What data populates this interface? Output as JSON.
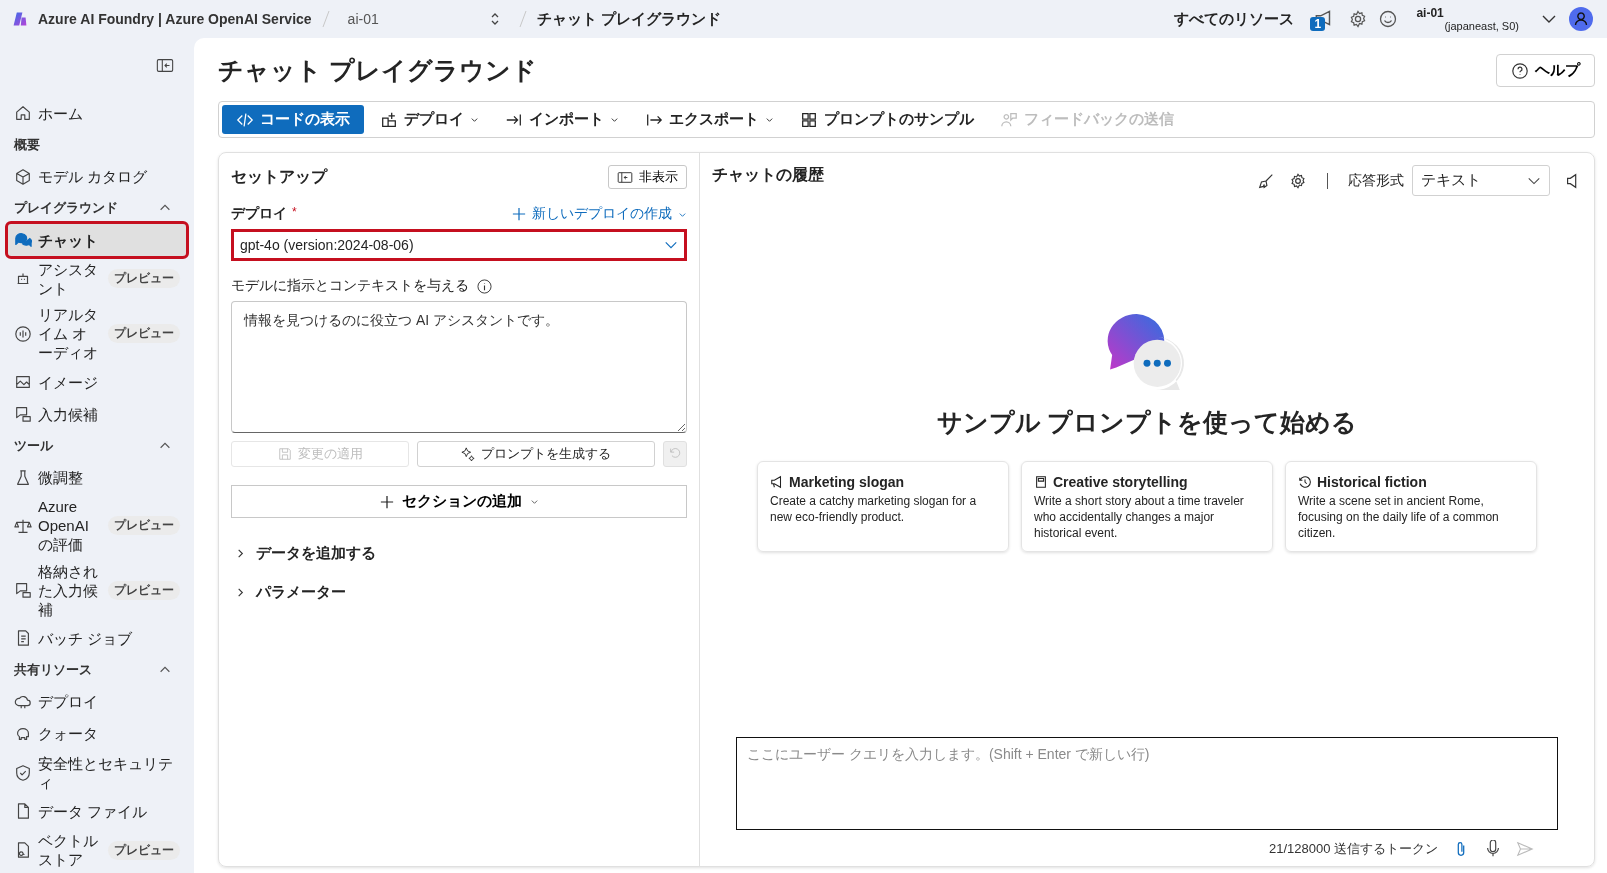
{
  "topbar": {
    "brand": "Azure AI Foundry | Azure OpenAI Service",
    "breadcrumb": [
      {
        "label": "ai-01",
        "kind": "selector"
      },
      {
        "label": "チャット プレイグラウンド",
        "kind": "page"
      }
    ],
    "resources_link": "すべてのリソース",
    "notification_count": "1",
    "account": {
      "name": "ai-01",
      "detail": "(japaneast, S0)"
    }
  },
  "sidebar": {
    "groups": [
      {
        "kind": "none",
        "items": [
          {
            "label": "ホーム",
            "selected": false,
            "highlighted": false
          }
        ]
      },
      {
        "kind": "static",
        "heading": "概要",
        "items": [
          {
            "label": "モデル カタログ",
            "selected": false,
            "highlighted": false
          }
        ]
      },
      {
        "kind": "collapsible",
        "heading": "プレイグラウンド",
        "expanded": true,
        "items": [
          {
            "label": "チャット",
            "selected": true,
            "highlighted": true
          },
          {
            "label": "アシスタント",
            "selected": false,
            "highlighted": false,
            "badge": "プレビュー"
          },
          {
            "label": "リアルタイム オーディオ",
            "selected": false,
            "highlighted": false,
            "badge": "プレビュー"
          },
          {
            "label": "イメージ",
            "selected": false,
            "highlighted": false
          },
          {
            "label": "入力候補",
            "selected": false,
            "highlighted": false
          }
        ]
      },
      {
        "kind": "collapsible",
        "heading": "ツール",
        "expanded": true,
        "items": [
          {
            "label": "微調整",
            "selected": false,
            "highlighted": false
          },
          {
            "label": "Azure OpenAI の評価",
            "selected": false,
            "highlighted": false,
            "badge": "プレビュー"
          },
          {
            "label": "格納された入力候補",
            "selected": false,
            "highlighted": false,
            "badge": "プレビュー"
          },
          {
            "label": "バッチ ジョブ",
            "selected": false,
            "highlighted": false
          }
        ]
      },
      {
        "kind": "collapsible",
        "heading": "共有リソース",
        "expanded": true,
        "items": [
          {
            "label": "デプロイ",
            "selected": false,
            "highlighted": false
          },
          {
            "label": "クォータ",
            "selected": false,
            "highlighted": false
          },
          {
            "label": "安全性とセキュリティ",
            "selected": false,
            "highlighted": false
          },
          {
            "label": "データ ファイル",
            "selected": false,
            "highlighted": false
          },
          {
            "label": "ベクトルストア",
            "selected": false,
            "highlighted": false,
            "badge": "プレビュー"
          }
        ]
      }
    ]
  },
  "page": {
    "title": "チャット プレイグラウンド",
    "help_button": "ヘルプ"
  },
  "toolbar": [
    {
      "label": "コードの表示",
      "kind": "primary",
      "has_menu": false,
      "disabled": false
    },
    {
      "label": "デプロイ",
      "kind": "default",
      "has_menu": true,
      "disabled": false
    },
    {
      "label": "インポート",
      "kind": "default",
      "has_menu": true,
      "disabled": false
    },
    {
      "label": "エクスポート",
      "kind": "default",
      "has_menu": true,
      "disabled": false
    },
    {
      "label": "プロンプトのサンプル",
      "kind": "default",
      "has_menu": false,
      "disabled": false
    },
    {
      "label": "フィードバックの送信",
      "kind": "default",
      "has_menu": false,
      "disabled": true
    }
  ],
  "setup": {
    "title": "セットアップ",
    "hide_button": "非表示",
    "deploy_label": "デプロイ",
    "required_mark": "*",
    "new_deploy_link": "新しいデプロイの作成",
    "deploy_select": {
      "value": "gpt-4o (version:2024-08-06)",
      "highlighted": true
    },
    "instructions_label": "モデルに指示とコンテキストを与える",
    "instructions_value": "情報を見つけるのに役立つ AI アシスタントです。",
    "apply_button": {
      "label": "変更の適用",
      "disabled": true
    },
    "generate_button": {
      "label": "プロンプトを生成する",
      "disabled": false
    },
    "reset_button": {
      "disabled": true
    },
    "add_section_button": "セクションの追加",
    "sections": [
      {
        "label": "データを追加する",
        "expanded": false
      },
      {
        "label": "パラメーター",
        "expanded": false
      }
    ]
  },
  "chat": {
    "title": "チャットの履歴",
    "response_format_label": "応答形式",
    "response_format_value": "テキスト",
    "heading": "サンプル プロンプトを使って始める",
    "samples": [
      {
        "title": "Marketing slogan",
        "text": "Create a catchy marketing slogan for a new eco-friendly product."
      },
      {
        "title": "Creative storytelling",
        "text": "Write a short story about a time traveler who accidentally changes a major historical event."
      },
      {
        "title": "Historical fiction",
        "text": "Write a scene set in ancient Rome, focusing on the daily life of a common citizen."
      }
    ],
    "input_placeholder": "ここにユーザー クエリを入力します。(Shift + Enter で新しい行)",
    "token_count": "21/128000 送信するトークン"
  }
}
